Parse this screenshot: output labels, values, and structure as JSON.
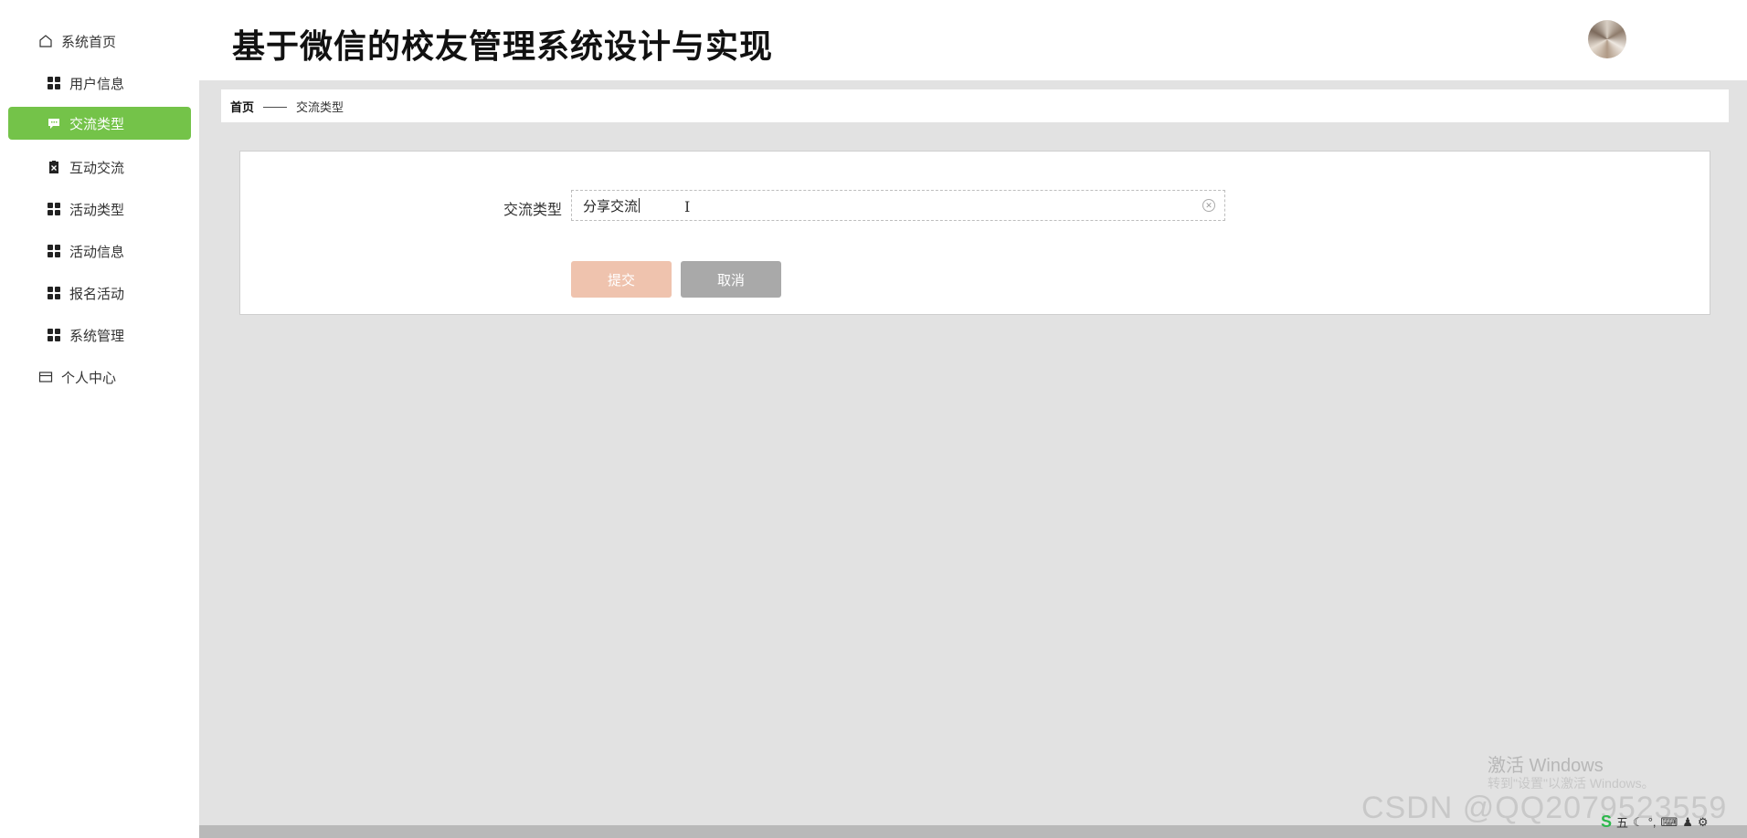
{
  "app": {
    "title": "基于微信的校友管理系统设计与实现"
  },
  "sidebar": {
    "items": [
      {
        "label": "系统首页",
        "icon": "home-icon"
      },
      {
        "label": "用户信息",
        "icon": "grid-icon"
      },
      {
        "label": "交流类型",
        "icon": "chat-icon",
        "active": true
      },
      {
        "label": "互动交流",
        "icon": "clipboard-icon"
      },
      {
        "label": "活动类型",
        "icon": "grid-icon"
      },
      {
        "label": "活动信息",
        "icon": "grid-icon"
      },
      {
        "label": "报名活动",
        "icon": "grid-icon"
      },
      {
        "label": "系统管理",
        "icon": "grid-icon"
      },
      {
        "label": "个人中心",
        "icon": "card-icon"
      }
    ]
  },
  "breadcrumb": {
    "home": "首页",
    "separator": "——",
    "current": "交流类型"
  },
  "form": {
    "field_label": "交流类型",
    "field_value": "分享交流",
    "submit_label": "提交",
    "cancel_label": "取消"
  },
  "overlay": {
    "windows_line1": "激活 Windows",
    "windows_line2": "转到\"设置\"以激活 Windows。",
    "watermark": "CSDN @QQ2079523559",
    "tray_ime": "五"
  },
  "colors": {
    "accent": "#74c349",
    "submit": "#efc3ae",
    "cancel": "#a9a9a9",
    "background": "#e2e2e2"
  }
}
